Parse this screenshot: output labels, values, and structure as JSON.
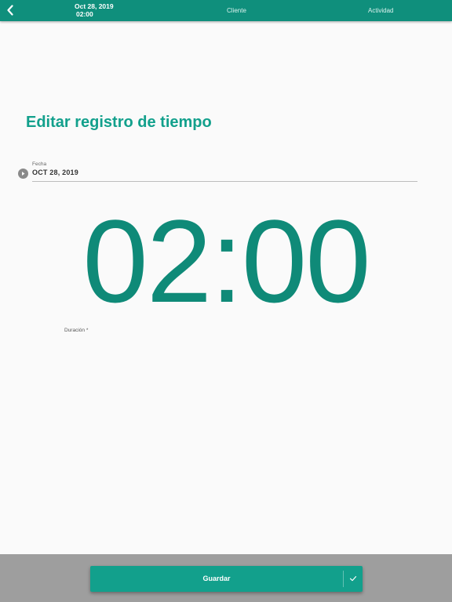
{
  "header": {
    "back_icon": "chevron-left-icon",
    "date": "Oct 28, 2019",
    "time": "02:00",
    "tabs": [
      {
        "label": "Cliente"
      },
      {
        "label": "Actividad"
      }
    ]
  },
  "main": {
    "title": "Editar registro de tiempo",
    "date_field": {
      "label": "Fecha",
      "value": "OCT 28, 2019",
      "icon": "expand-arrow-icon"
    },
    "duration": {
      "value": "02:00",
      "label": "Duración *"
    }
  },
  "footer": {
    "save_label": "Guardar",
    "check_icon": "check-icon"
  },
  "colors": {
    "primary": "#0f8f7c",
    "accent": "#12a08c",
    "background": "#fafafa",
    "footer_bg": "#9e9e9e"
  }
}
